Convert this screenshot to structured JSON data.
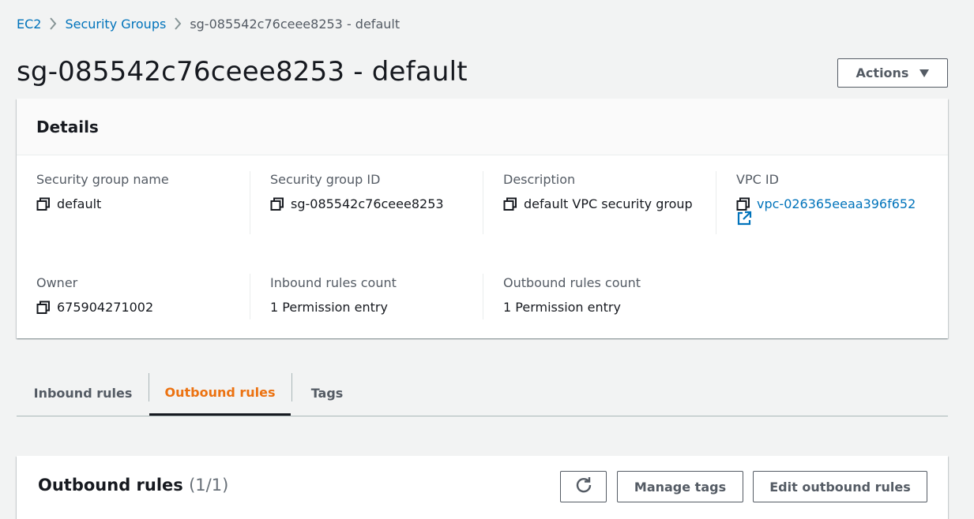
{
  "breadcrumb": {
    "items": [
      "EC2",
      "Security Groups"
    ],
    "current": "sg-085542c76ceee8253 - default"
  },
  "page": {
    "title": "sg-085542c76ceee8253 - default",
    "actions_label": "Actions"
  },
  "details": {
    "title": "Details",
    "fields": {
      "sg_name": {
        "label": "Security group name",
        "value": "default"
      },
      "sg_id": {
        "label": "Security group ID",
        "value": "sg-085542c76ceee8253"
      },
      "description": {
        "label": "Description",
        "value": "default VPC security group"
      },
      "vpc_id": {
        "label": "VPC ID",
        "value": "vpc-026365eeaa396f652"
      },
      "owner": {
        "label": "Owner",
        "value": "675904271002"
      },
      "inbound_count": {
        "label": "Inbound rules count",
        "value": "1 Permission entry"
      },
      "outbound_count": {
        "label": "Outbound rules count",
        "value": "1 Permission entry"
      }
    }
  },
  "tabs": {
    "items": [
      "Inbound rules",
      "Outbound rules",
      "Tags"
    ],
    "active": "Outbound rules"
  },
  "outbound": {
    "title": "Outbound rules",
    "count": "(1/1)",
    "manage_tags_label": "Manage tags",
    "edit_label": "Edit outbound rules"
  },
  "icons": {
    "breadcrumb_separator": "chevron-right-icon",
    "copy": "copy-icon",
    "external_link": "external-link-icon",
    "refresh": "refresh-icon",
    "actions_caret": "caret-down-icon"
  },
  "colors": {
    "link": "#0073bb",
    "active_tab": "#ec7211",
    "text": "#16191f",
    "secondary_text": "#545b64",
    "background": "#f2f3f3"
  }
}
